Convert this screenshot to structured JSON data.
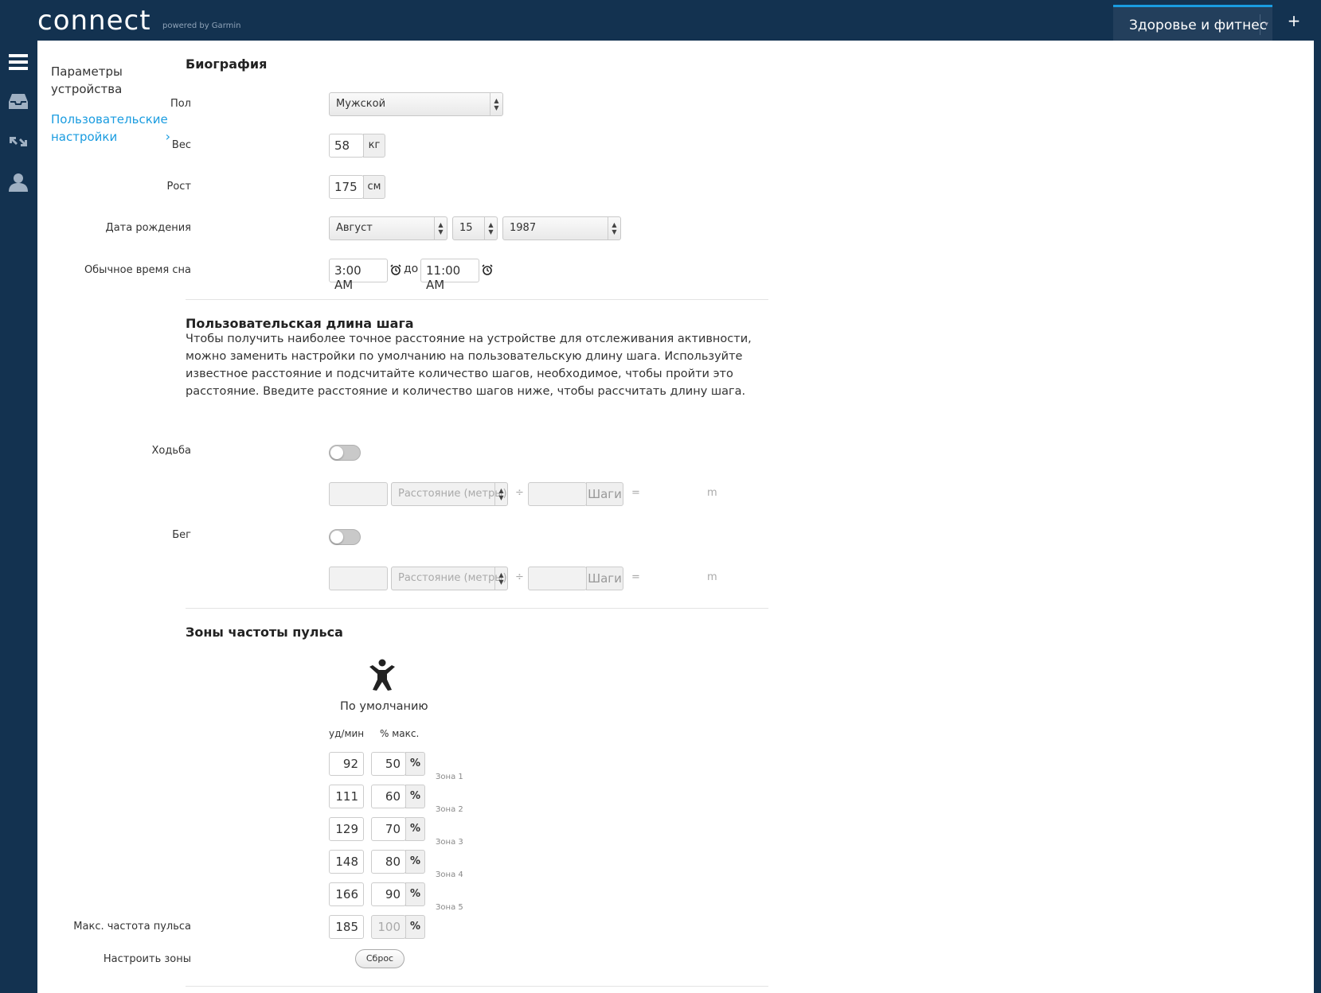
{
  "header": {
    "logo": "connect",
    "powered_by": "powered by Garmin",
    "app_switcher": "Здоровье и фитнес",
    "add": "+"
  },
  "sidebar_icons": [
    "menu-icon",
    "inbox-icon",
    "connections-icon",
    "user-icon"
  ],
  "subnav": {
    "device": "Параметры устройства",
    "user": "Пользовательские настройки"
  },
  "bio": {
    "title": "Биография",
    "gender_label": "Пол",
    "gender_value": "Мужской",
    "weight_label": "Вес",
    "weight_value": "58",
    "weight_unit": "кг",
    "height_label": "Рост",
    "height_value": "175",
    "height_unit": "см",
    "birth_label": "Дата рождения",
    "birth_month": "Август",
    "birth_day": "15",
    "birth_year": "1987",
    "sleep_label": "Обычное время сна",
    "sleep_from": "3:00 AM",
    "sleep_to_word": "до",
    "sleep_to": "11:00 AM"
  },
  "stride": {
    "title": "Пользовательская длина шага",
    "description": "Чтобы получить наиболее точное расстояние на устройстве для отслеживания активности, можно заменить настройки по умолчанию на пользовательскую длину шага. Используйте известное расстояние и подсчитайте количество шагов, необходимое, чтобы пройти это расстояние. Введите расстояние и количество шагов ниже, чтобы рассчитать длину шага.",
    "walk_label": "Ходьба",
    "run_label": "Бег",
    "distance_placeholder": "Расстояние (метры)",
    "steps_label": "Шаги",
    "divide": "÷",
    "equals": "=",
    "unit": "m"
  },
  "hr": {
    "title": "Зоны частоты пульса",
    "profile": "По умолчанию",
    "col_bpm": "уд/мин",
    "col_pct": "% макс.",
    "pct_sign": "%",
    "zones": [
      {
        "bpm": "92",
        "pct": "50",
        "label": "Зона 1"
      },
      {
        "bpm": "111",
        "pct": "60",
        "label": "Зона 2"
      },
      {
        "bpm": "129",
        "pct": "70",
        "label": "Зона 3"
      },
      {
        "bpm": "148",
        "pct": "80",
        "label": "Зона 4"
      },
      {
        "bpm": "166",
        "pct": "90",
        "label": "Зона 5"
      }
    ],
    "max_label": "Макс. частота пульса",
    "max_bpm": "185",
    "max_pct": "100",
    "configure_label": "Настроить зоны",
    "reset": "Сброс"
  }
}
